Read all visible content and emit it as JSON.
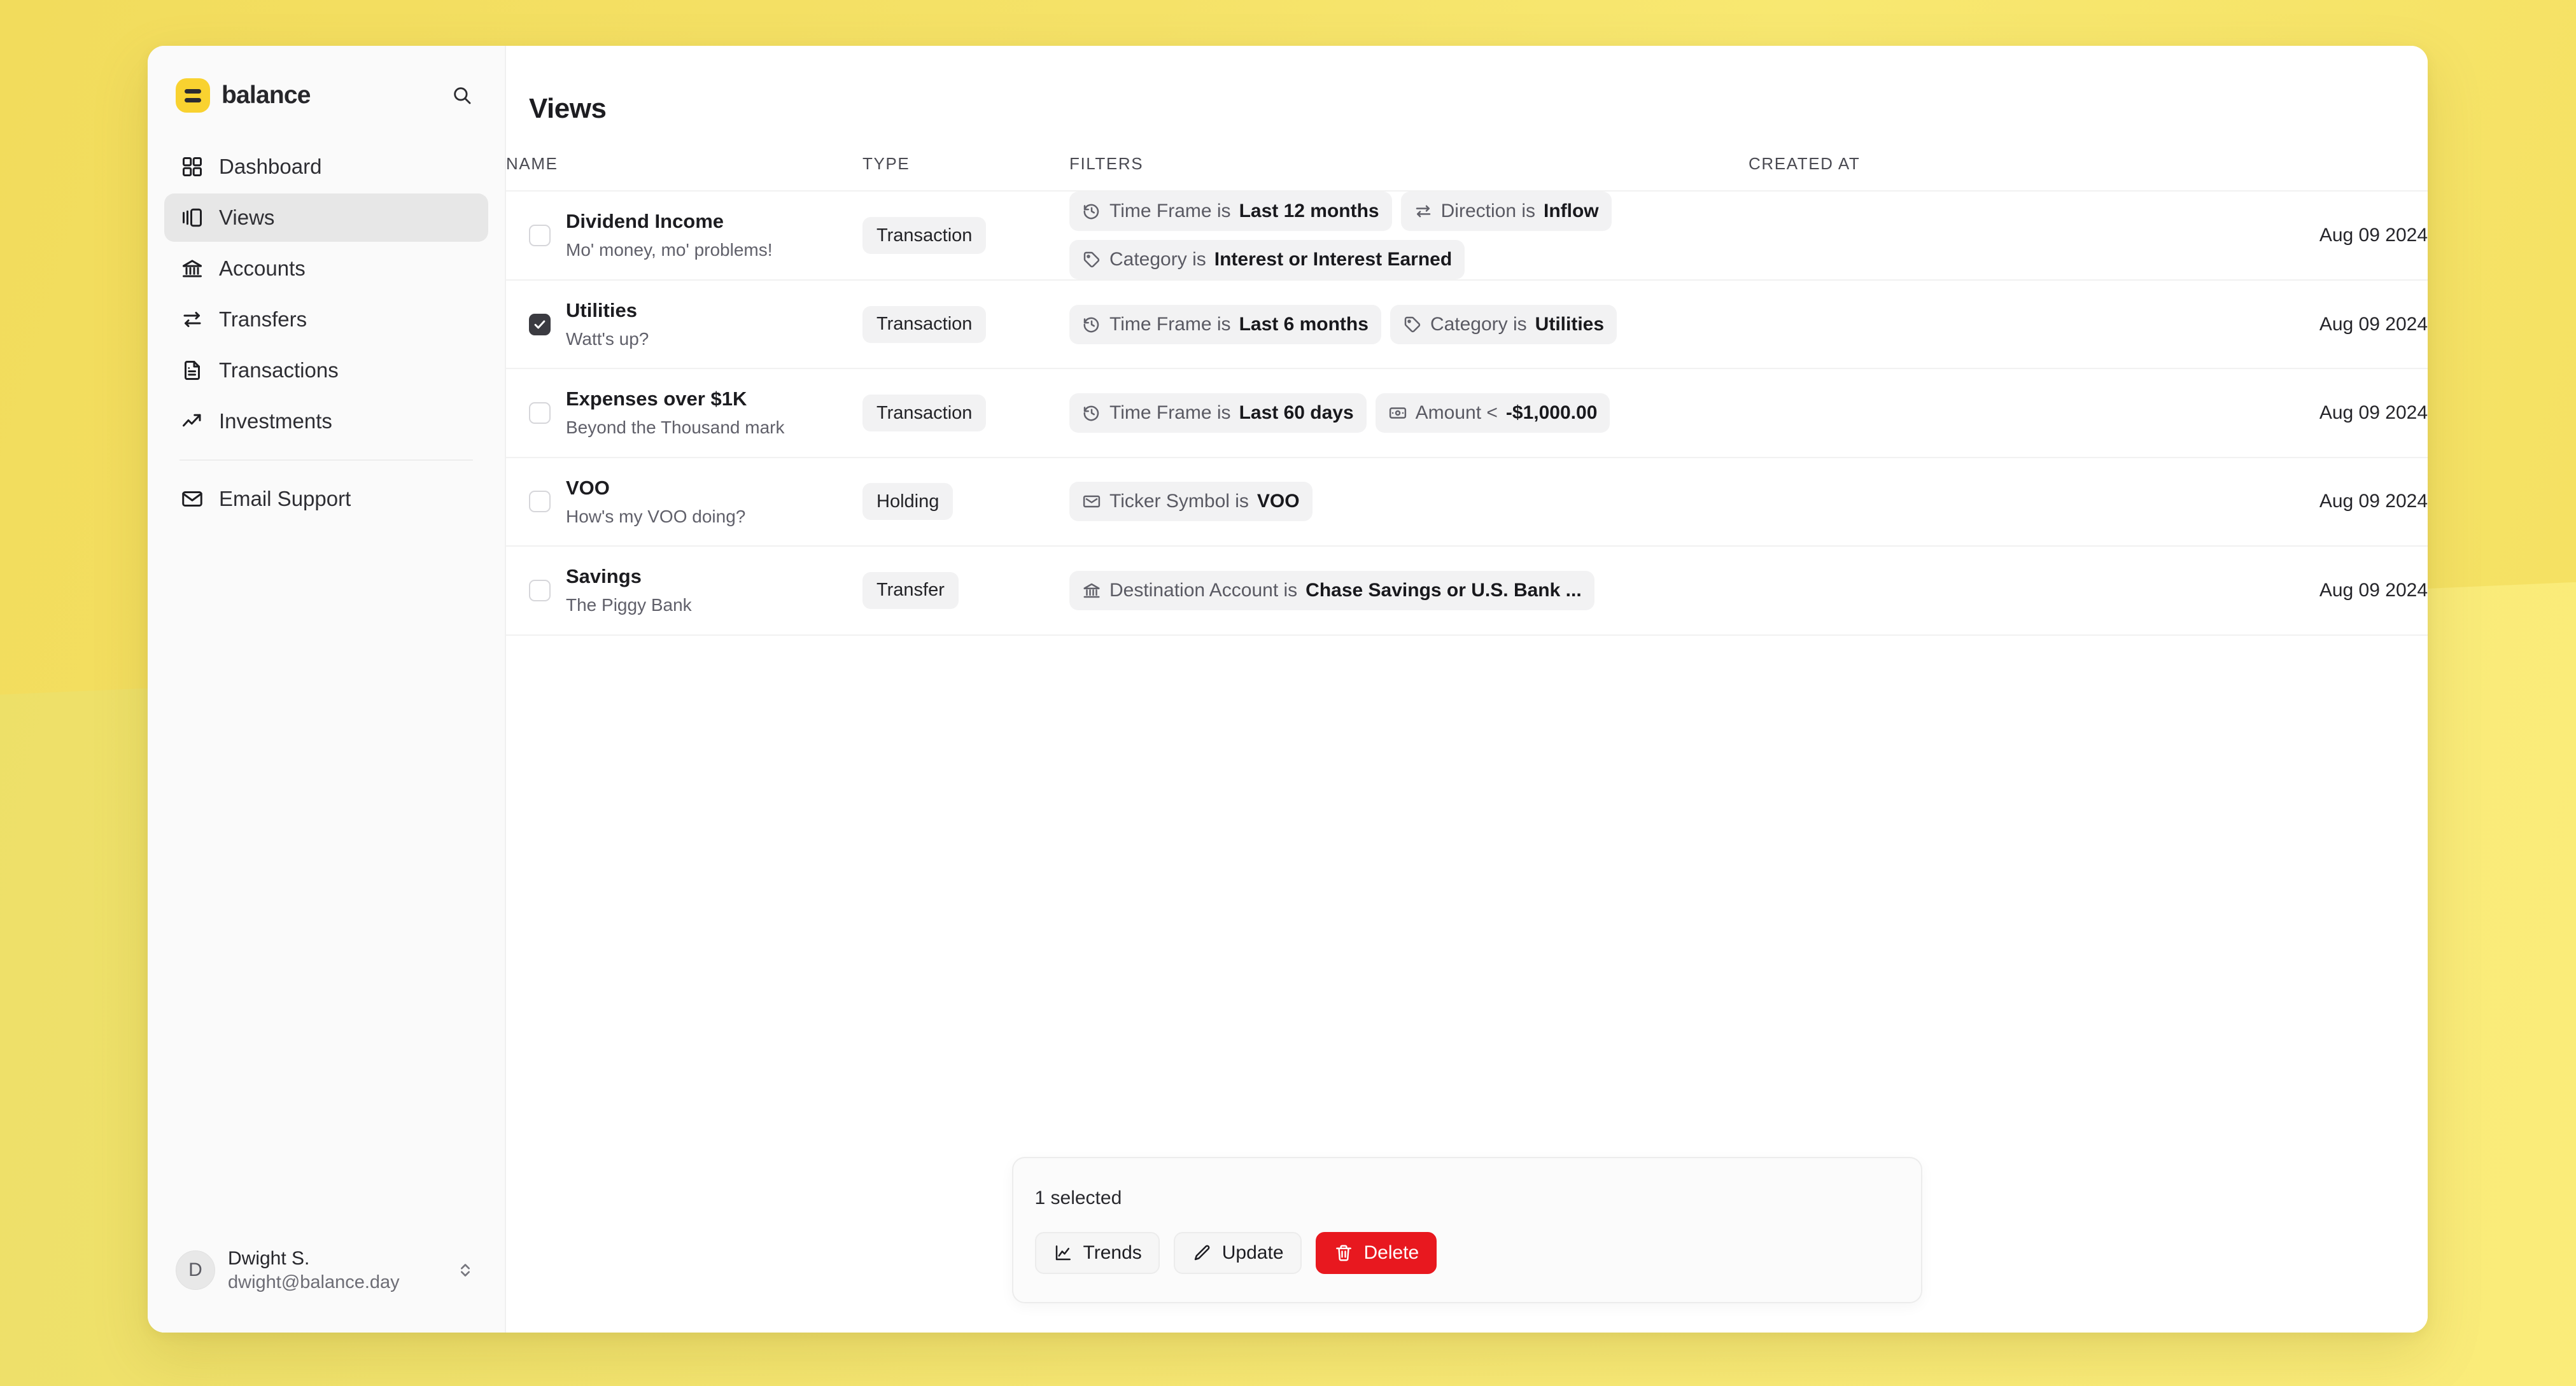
{
  "brand": {
    "name": "balance",
    "logo_icon": "equals-logo-icon",
    "search_icon": "search-icon"
  },
  "sidebar": {
    "items": [
      {
        "label": "Dashboard",
        "icon": "grid-icon",
        "active": false
      },
      {
        "label": "Views",
        "icon": "panels-icon",
        "active": true
      },
      {
        "label": "Accounts",
        "icon": "bank-icon",
        "active": false
      },
      {
        "label": "Transfers",
        "icon": "transfer-arrows-icon",
        "active": false
      },
      {
        "label": "Transactions",
        "icon": "document-icon",
        "active": false
      },
      {
        "label": "Investments",
        "icon": "trending-up-icon",
        "active": false
      }
    ],
    "support": {
      "label": "Email Support",
      "icon": "envelope-icon"
    },
    "user": {
      "initial": "D",
      "name": "Dwight S.",
      "email": "dwight@balance.day",
      "chevrons_icon": "chevron-up-down-icon"
    }
  },
  "main": {
    "title": "Views",
    "columns": {
      "name": "NAME",
      "type": "TYPE",
      "filters": "FILTERS",
      "created_at": "CREATED AT"
    },
    "rows": [
      {
        "checked": false,
        "name": "Dividend Income",
        "description": "Mo' money, mo' problems!",
        "type": "Transaction",
        "created_at": "Aug 09 2024",
        "filters": [
          {
            "icon": "history-icon",
            "label": "Time Frame is",
            "value": "Last 12 months"
          },
          {
            "icon": "direction-icon",
            "label": "Direction is",
            "value": "Inflow"
          },
          {
            "icon": "tag-icon",
            "label": "Category is",
            "value": "Interest or Interest Earned"
          }
        ]
      },
      {
        "checked": true,
        "name": "Utilities",
        "description": "Watt's up?",
        "type": "Transaction",
        "created_at": "Aug 09 2024",
        "filters": [
          {
            "icon": "history-icon",
            "label": "Time Frame is",
            "value": "Last 6 months"
          },
          {
            "icon": "tag-icon",
            "label": "Category is",
            "value": "Utilities"
          }
        ]
      },
      {
        "checked": false,
        "name": "Expenses over $1K",
        "description": "Beyond the Thousand mark",
        "type": "Transaction",
        "created_at": "Aug 09 2024",
        "filters": [
          {
            "icon": "history-icon",
            "label": "Time Frame is",
            "value": "Last 60 days"
          },
          {
            "icon": "banknote-icon",
            "label": "Amount <",
            "value": "-$1,000.00"
          }
        ]
      },
      {
        "checked": false,
        "name": "VOO",
        "description": "How's my VOO doing?",
        "type": "Holding",
        "created_at": "Aug 09 2024",
        "filters": [
          {
            "icon": "ticket-icon",
            "label": "Ticker Symbol is",
            "value": "VOO"
          }
        ]
      },
      {
        "checked": false,
        "name": "Savings",
        "description": "The Piggy Bank",
        "type": "Transfer",
        "created_at": "Aug 09 2024",
        "filters": [
          {
            "icon": "bank-icon",
            "label": "Destination Account is",
            "value": "Chase Savings or U.S. Bank ..."
          }
        ]
      }
    ]
  },
  "action_bar": {
    "selected_text": "1 selected",
    "buttons": [
      {
        "label": "Trends",
        "icon": "line-chart-icon",
        "variant": "default"
      },
      {
        "label": "Update",
        "icon": "pencil-icon",
        "variant": "default"
      },
      {
        "label": "Delete",
        "icon": "trash-icon",
        "variant": "danger"
      }
    ]
  },
  "colors": {
    "backdrop_yellow": "#f6e05e",
    "brand_yellow": "#f9d230",
    "danger_red": "#e8181f",
    "active_nav": "#e7e7e7",
    "chip_grey": "#f2f2f3"
  }
}
